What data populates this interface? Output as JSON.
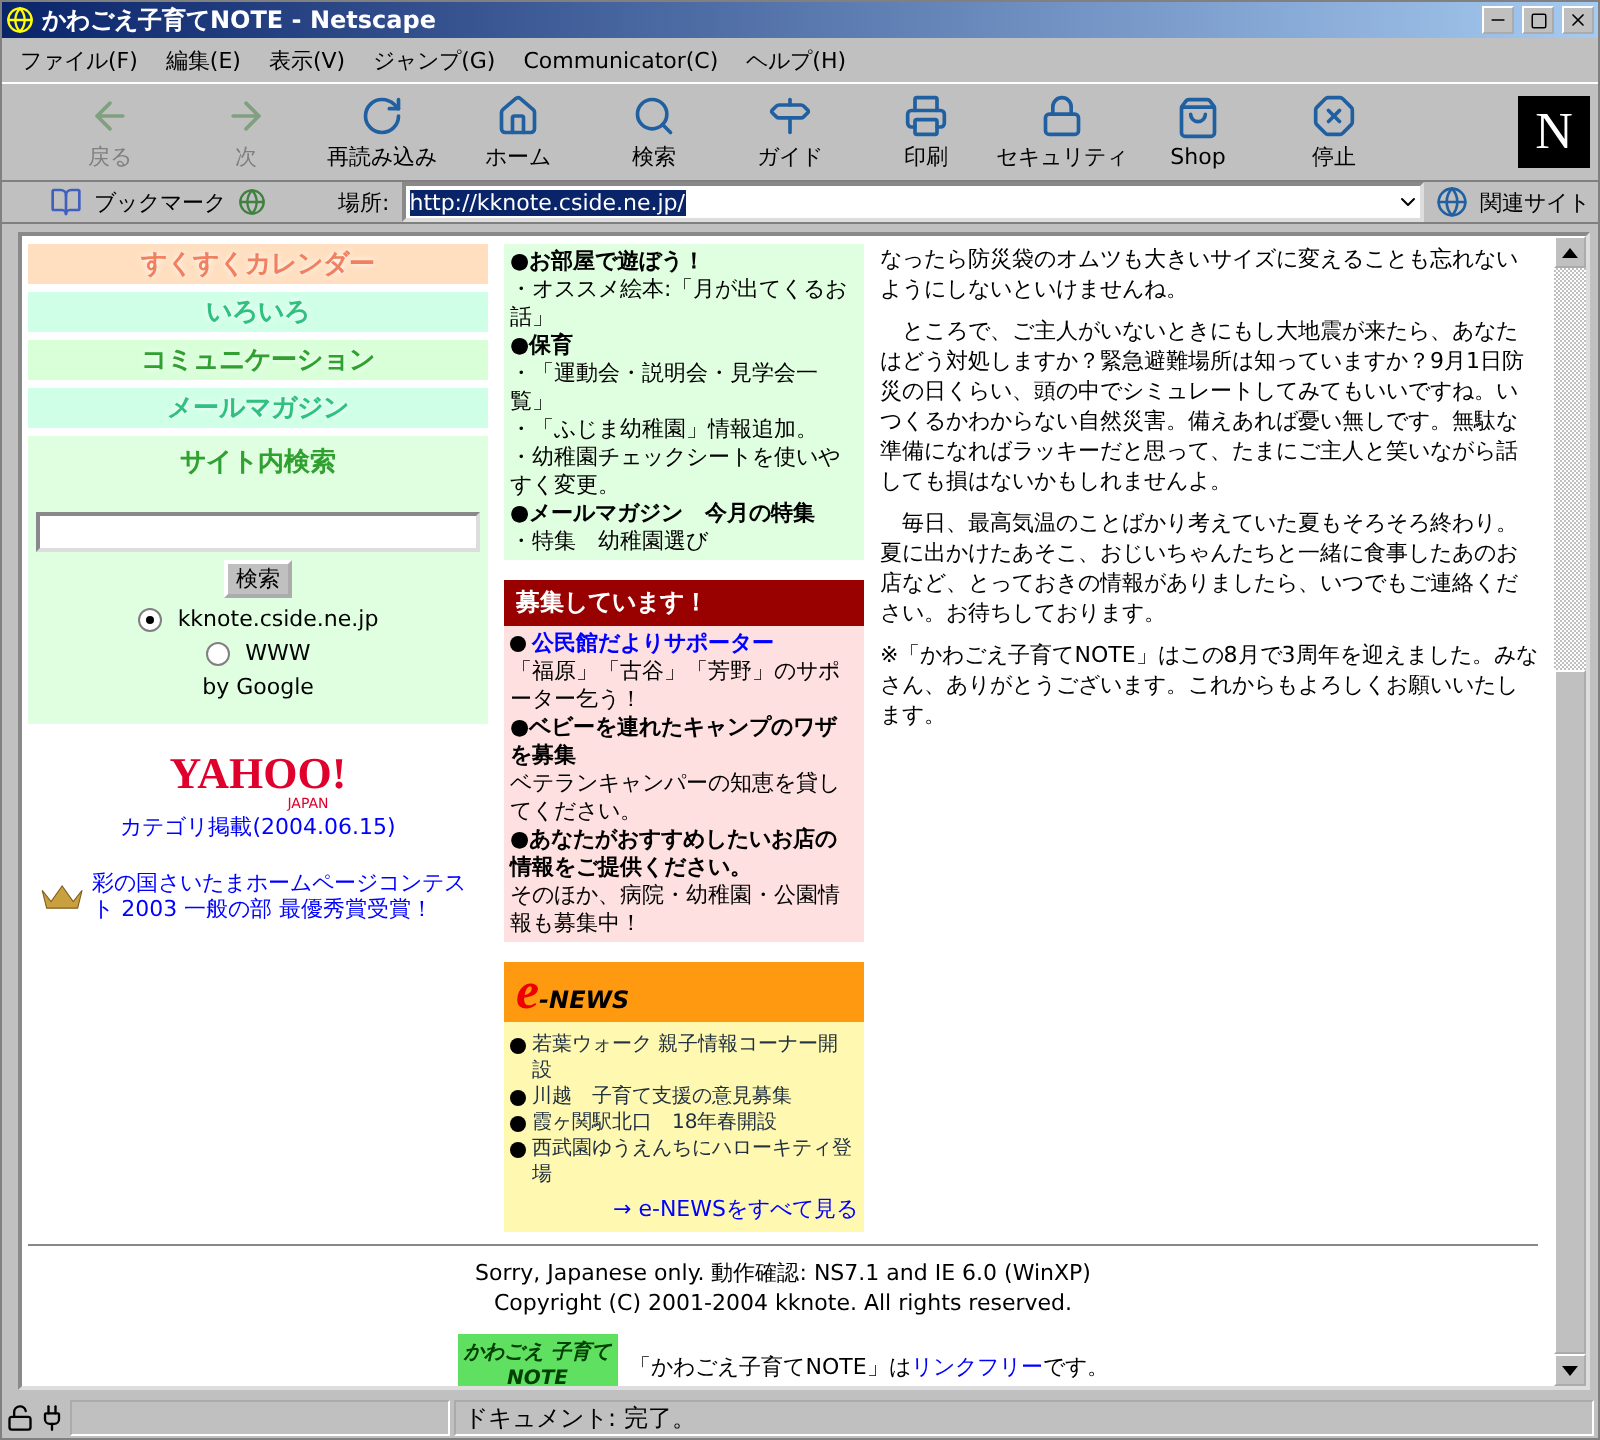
{
  "window": {
    "title": "かわごえ子育てNOTE - Netscape"
  },
  "menu": [
    "ファイル(F)",
    "編集(E)",
    "表示(V)",
    "ジャンプ(G)",
    "Communicator(C)",
    "ヘルプ(H)"
  ],
  "toolbar": [
    {
      "label": "戻る",
      "disabled": true
    },
    {
      "label": "次",
      "disabled": true
    },
    {
      "label": "再読み込み",
      "disabled": false
    },
    {
      "label": "ホーム",
      "disabled": false
    },
    {
      "label": "検索",
      "disabled": false
    },
    {
      "label": "ガイド",
      "disabled": false
    },
    {
      "label": "印刷",
      "disabled": false
    },
    {
      "label": "セキュリティ",
      "disabled": false
    },
    {
      "label": "Shop",
      "disabled": false
    },
    {
      "label": "停止",
      "disabled": false
    }
  ],
  "logo": "N",
  "location": {
    "bookmarks": "ブックマーク",
    "label": "場所:",
    "url": "http://kknote.cside.ne.jp/",
    "related": "関連サイト"
  },
  "nav": [
    {
      "label": "すくすくカレンダー",
      "color": "#ffdfc0"
    },
    {
      "label": "いろいろ",
      "color": "#d0ffe8"
    },
    {
      "label": "コミュニケーション",
      "color": "#d8ffd8"
    },
    {
      "label": "メールマガジン",
      "color": "#d0ffe8"
    }
  ],
  "search": {
    "title": "サイト内検索",
    "button": "検索",
    "options": [
      {
        "label": "kknote.cside.ne.jp",
        "selected": true
      },
      {
        "label": "WWW",
        "selected": false
      }
    ],
    "by": "by Google"
  },
  "yahoo": {
    "logo": "YAHOO!",
    "sub": "JAPAN",
    "link": "カテゴリ掲載(2004.06.15)"
  },
  "award": {
    "link": "彩の国さいたまホームページコンテスト 2003 一般の部 最優秀賞受賞！"
  },
  "updates": [
    {
      "kind": "heading",
      "text": "●お部屋で遊ぼう！"
    },
    {
      "kind": "line",
      "text": "・オススメ絵本:「月が出てくるお話」"
    },
    {
      "kind": "heading",
      "text": "●保育"
    },
    {
      "kind": "line",
      "text": "・「運動会・説明会・見学会一覧」"
    },
    {
      "kind": "line",
      "text": "・「ふじま幼稚園」情報追加。"
    },
    {
      "kind": "line",
      "text": "・幼稚園チェックシートを使いやすく変更。"
    },
    {
      "kind": "heading",
      "text": "●メールマガジン　今月の特集"
    },
    {
      "kind": "line",
      "text": "・特集　幼稚園選び"
    }
  ],
  "recruit": {
    "title": "募集しています！",
    "items": [
      {
        "kind": "link",
        "text": "公民館だよりサポーター"
      },
      {
        "kind": "line",
        "text": "「福原」「古谷」「芳野」のサポーター乞う！"
      },
      {
        "kind": "heading",
        "text": "●ベビーを連れたキャンプのワザを募集"
      },
      {
        "kind": "line",
        "text": "ベテランキャンパーの知恵を貸してください。"
      },
      {
        "kind": "heading",
        "text": "●あなたがおすすめしたいお店の情報をご提供ください。"
      },
      {
        "kind": "line",
        "text": "そのほか、病院・幼稚園・公園情報も募集中！"
      }
    ]
  },
  "enews": {
    "logo_e": "e",
    "logo_rest": "-NEWS",
    "items": [
      "若葉ウォーク 親子情報コーナー開設",
      "川越　子育て支援の意見募集",
      "霞ヶ関駅北口　18年春開設",
      "西武園ゆうえんちにハローキティ登場"
    ],
    "more": "→ e-NEWSをすべて見る"
  },
  "article": [
    "なったら防災袋のオムツも大きいサイズに変えることも忘れないようにしないといけませんね。",
    "　ところで、ご主人がいないときにもし大地震が来たら、あなたはどう対処しますか？緊急避難場所は知っていますか？9月1日防災の日くらい、頭の中でシミュレートしてみてもいいですね。いつくるかわからない自然災害。備えあれば憂い無しです。無駄な準備になればラッキーだと思って、たまにご主人と笑いながら話しても損はないかもしれませんよ。",
    "　毎日、最高気温のことばかり考えていた夏もそろそろ終わり。夏に出かけたあそこ、おじいちゃんたちと一緒に食事したあのお店など、とっておきの情報がありましたら、いつでもご連絡ください。お待ちしております。",
    "※「かわごえ子育てNOTE」はこの8月で3周年を迎えました。みなさん、ありがとうございます。これからもよろしくお願いいたします。"
  ],
  "footer": {
    "lines": [
      "Sorry, Japanese only. 動作確認: NS7.1 and IE 6.0 (WinXP)",
      "Copyright (C) 2001-2004 kknote. All rights reserved."
    ],
    "banner": "かわごえ 子育てNOTE",
    "before": "「かわごえ子育てNOTE」は",
    "link": "リンクフリー",
    "after": "です。"
  },
  "status": "ドキュメント: 完了。"
}
